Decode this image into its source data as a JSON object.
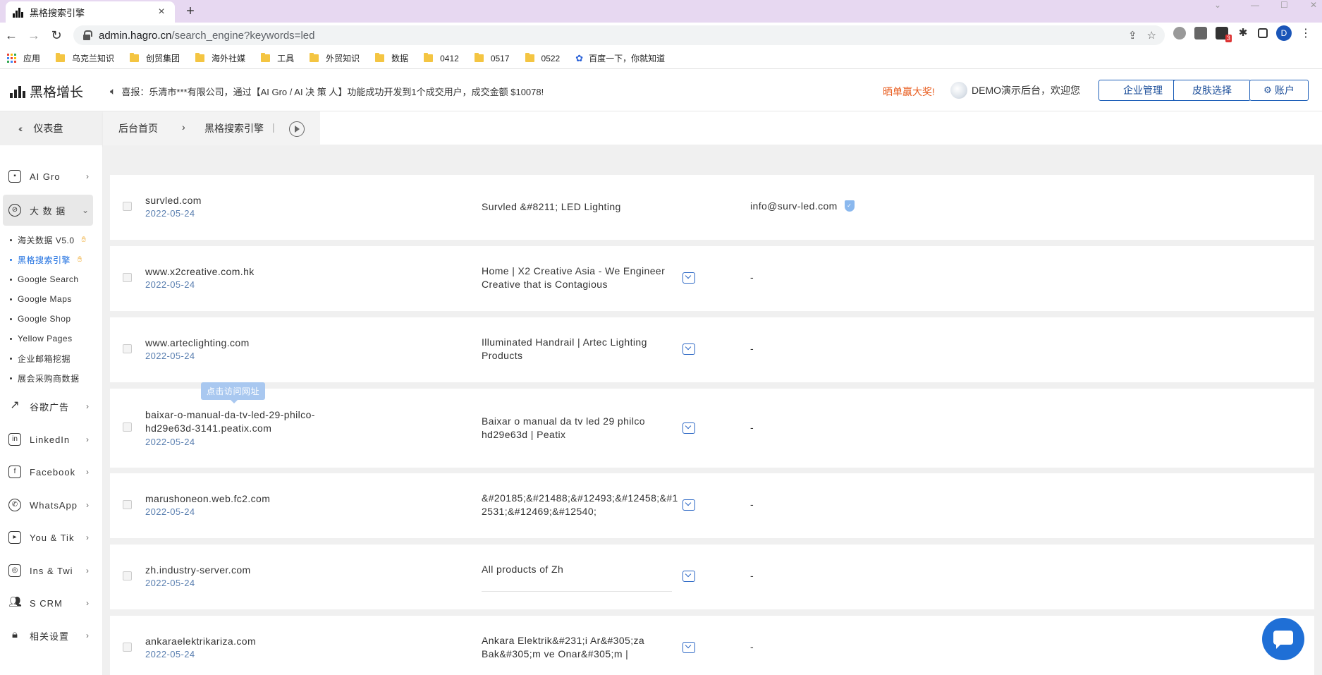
{
  "browser": {
    "tab_title": "黑格搜索引擎",
    "tab_close": "×",
    "new_tab": "+",
    "url_host": "admin.hagro.cn",
    "url_path": "/search_engine?keywords=led",
    "profile_initial": "D",
    "ext_badge": "3"
  },
  "bookmarks": [
    {
      "label": "应用",
      "icon": "apps-grid-icon"
    },
    {
      "label": "乌克兰知识",
      "icon": "folder-icon"
    },
    {
      "label": "创贸集团",
      "icon": "folder-icon"
    },
    {
      "label": "海外社媒",
      "icon": "folder-icon"
    },
    {
      "label": "工具",
      "icon": "folder-icon"
    },
    {
      "label": "外贸知识",
      "icon": "folder-icon"
    },
    {
      "label": "数据",
      "icon": "folder-icon"
    },
    {
      "label": "0412",
      "icon": "folder-icon"
    },
    {
      "label": "0517",
      "icon": "folder-icon"
    },
    {
      "label": "0522",
      "icon": "folder-icon"
    },
    {
      "label": "百度一下，你就知道",
      "icon": "baidu-paw-icon"
    }
  ],
  "header": {
    "logo_text": "黑格增长",
    "announcement": "喜报：乐清市***有限公司，通过【AI Gro / AI 决 策 人】功能成功开发到1个成交用户，成交金额 $10078!",
    "promo": "晒单赢大奖!",
    "welcome": "DEMO演示后台，欢迎您",
    "btn_company": "企业管理",
    "btn_skin": "皮肤选择",
    "btn_account": "账户"
  },
  "sidebar": {
    "dashboard": "仪表盘",
    "menu": [
      {
        "label": "AI Gro",
        "icon": "chip-icon"
      },
      {
        "label": "大 数 据",
        "icon": "compass-icon"
      },
      {
        "label": "谷歌广告",
        "icon": "trend-icon"
      },
      {
        "label": "LinkedIn",
        "icon": "linkedin-icon"
      },
      {
        "label": "Facebook",
        "icon": "facebook-icon"
      },
      {
        "label": "WhatsApp",
        "icon": "whatsapp-icon"
      },
      {
        "label": "You & Tik",
        "icon": "youtube-icon"
      },
      {
        "label": "Ins & Twi",
        "icon": "instagram-icon"
      },
      {
        "label": "S CRM",
        "icon": "users-icon"
      },
      {
        "label": "相关设置",
        "icon": "lock-icon"
      }
    ],
    "sub_items": [
      {
        "label": "海关数据 V5.0"
      },
      {
        "label": "黑格搜索引擎"
      },
      {
        "label": "Google Search"
      },
      {
        "label": "Google Maps"
      },
      {
        "label": "Google Shop"
      },
      {
        "label": "Yellow Pages"
      },
      {
        "label": "企业邮箱挖掘"
      },
      {
        "label": "展会采购商数据"
      }
    ]
  },
  "breadcrumb": {
    "home": "后台首页",
    "sep": "›",
    "current": "黑格搜索引擎",
    "pipe": "|"
  },
  "tooltip": "点击访问网址",
  "results": [
    {
      "domain": "survled.com",
      "date": "2022-05-24",
      "title": "Survled &#8211; LED Lighting",
      "email": "info@surv-led.com"
    },
    {
      "domain": "www.x2creative.com.hk",
      "date": "2022-05-24",
      "title": "Home | X2 Creative Asia - We Engineer Creative that is Contagious",
      "email": "-"
    },
    {
      "domain": "www.arteclighting.com",
      "date": "2022-05-24",
      "title": "Illuminated Handrail | Artec Lighting Products",
      "email": "-"
    },
    {
      "domain": "baixar-o-manual-da-tv-led-29-philco-hd29e63d-3141.peatix.com",
      "date": "2022-05-24",
      "title": "Baixar o manual da tv led 29 philco hd29e63d | Peatix",
      "email": "-"
    },
    {
      "domain": "marushoneon.web.fc2.com",
      "date": "2022-05-24",
      "title": "&#20185;&#21488;&#12493;&#12458;&#12531;&#12469;&#12540;",
      "email": "-"
    },
    {
      "domain": "zh.industry-server.com",
      "date": "2022-05-24",
      "title": "All products of Zh",
      "email": "-"
    },
    {
      "domain": "ankaraelektrikariza.com",
      "date": "2022-05-24",
      "title": "Ankara Elektrik&#231;i Ar&#305;za Bak&#305;m ve Onar&#305;m |",
      "email": "-"
    }
  ]
}
